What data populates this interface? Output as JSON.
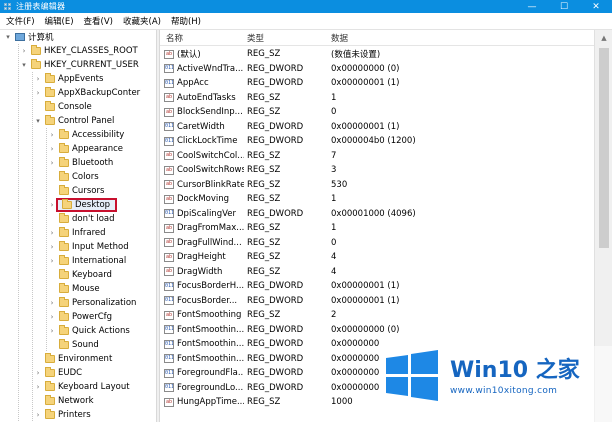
{
  "window": {
    "title": "注册表编辑器",
    "controls": [
      "—",
      "☐",
      "✕"
    ]
  },
  "menu": [
    "文件(F)",
    "编辑(E)",
    "查看(V)",
    "收藏夹(A)",
    "帮助(H)"
  ],
  "tree": {
    "root": "计算机",
    "nodes": [
      {
        "label": "HKEY_CLASSES_ROOT"
      },
      {
        "label": "HKEY_CURRENT_USER"
      },
      {
        "label": "AppEvents"
      },
      {
        "label": "AppXBackupConter"
      },
      {
        "label": "Console"
      },
      {
        "label": "Control Panel"
      },
      {
        "label": "Accessibility"
      },
      {
        "label": "Appearance"
      },
      {
        "label": "Bluetooth"
      },
      {
        "label": "Colors"
      },
      {
        "label": "Cursors"
      },
      {
        "label": "Desktop",
        "selected": true
      },
      {
        "label": "don't load"
      },
      {
        "label": "Infrared"
      },
      {
        "label": "Input Method"
      },
      {
        "label": "International"
      },
      {
        "label": "Keyboard"
      },
      {
        "label": "Mouse"
      },
      {
        "label": "Personalization"
      },
      {
        "label": "PowerCfg"
      },
      {
        "label": "Quick Actions"
      },
      {
        "label": "Sound"
      },
      {
        "label": "Environment"
      },
      {
        "label": "EUDC"
      },
      {
        "label": "Keyboard Layout"
      },
      {
        "label": "Network"
      },
      {
        "label": "Printers"
      }
    ]
  },
  "list": {
    "headers": {
      "name": "名称",
      "type": "类型",
      "data": "数据"
    },
    "rows": [
      {
        "icon": "ab",
        "name": "(默认)",
        "type": "REG_SZ",
        "data": "(数值未设置)"
      },
      {
        "icon": "dw",
        "name": "ActiveWndTra...",
        "type": "REG_DWORD",
        "data": "0x00000000 (0)"
      },
      {
        "icon": "dw",
        "name": "AppAcc",
        "type": "REG_DWORD",
        "data": "0x00000001 (1)"
      },
      {
        "icon": "ab",
        "name": "AutoEndTasks",
        "type": "REG_SZ",
        "data": "1"
      },
      {
        "icon": "ab",
        "name": "BlockSendInp...",
        "type": "REG_SZ",
        "data": "0"
      },
      {
        "icon": "dw",
        "name": "CaretWidth",
        "type": "REG_DWORD",
        "data": "0x00000001 (1)"
      },
      {
        "icon": "dw",
        "name": "ClickLockTime",
        "type": "REG_DWORD",
        "data": "0x000004b0 (1200)"
      },
      {
        "icon": "ab",
        "name": "CoolSwitchCol...",
        "type": "REG_SZ",
        "data": "7"
      },
      {
        "icon": "ab",
        "name": "CoolSwitchRows",
        "type": "REG_SZ",
        "data": "3"
      },
      {
        "icon": "ab",
        "name": "CursorBlinkRate",
        "type": "REG_SZ",
        "data": "530"
      },
      {
        "icon": "ab",
        "name": "DockMoving",
        "type": "REG_SZ",
        "data": "1"
      },
      {
        "icon": "dw",
        "name": "DpiScalingVer",
        "type": "REG_DWORD",
        "data": "0x00001000 (4096)"
      },
      {
        "icon": "ab",
        "name": "DragFromMax...",
        "type": "REG_SZ",
        "data": "1"
      },
      {
        "icon": "ab",
        "name": "DragFullWind...",
        "type": "REG_SZ",
        "data": "0"
      },
      {
        "icon": "ab",
        "name": "DragHeight",
        "type": "REG_SZ",
        "data": "4"
      },
      {
        "icon": "ab",
        "name": "DragWidth",
        "type": "REG_SZ",
        "data": "4"
      },
      {
        "icon": "dw",
        "name": "FocusBorderH...",
        "type": "REG_DWORD",
        "data": "0x00000001 (1)"
      },
      {
        "icon": "dw",
        "name": "FocusBorder...",
        "type": "REG_DWORD",
        "data": "0x00000001 (1)"
      },
      {
        "icon": "ab",
        "name": "FontSmoothing",
        "type": "REG_SZ",
        "data": "2"
      },
      {
        "icon": "dw",
        "name": "FontSmoothin...",
        "type": "REG_DWORD",
        "data": "0x00000000 (0)"
      },
      {
        "icon": "dw",
        "name": "FontSmoothin...",
        "type": "REG_DWORD",
        "data": "0x0000000"
      },
      {
        "icon": "dw",
        "name": "FontSmoothin...",
        "type": "REG_DWORD",
        "data": "0x0000000"
      },
      {
        "icon": "dw",
        "name": "ForegroundFla...",
        "type": "REG_DWORD",
        "data": "0x0000000"
      },
      {
        "icon": "dw",
        "name": "ForegroundLo...",
        "type": "REG_DWORD",
        "data": "0x0000000"
      },
      {
        "icon": "ab",
        "name": "HungAppTime...",
        "type": "REG_SZ",
        "data": "1000"
      }
    ]
  },
  "watermark": {
    "brand": "Win10 之家",
    "url": "www.win10xitong.com",
    "colors": {
      "blue": "#1e88e5",
      "dark": "#1565c0"
    }
  },
  "colors": {
    "titlebar": "#0b8ee0",
    "selection_border": "#c8102e"
  }
}
